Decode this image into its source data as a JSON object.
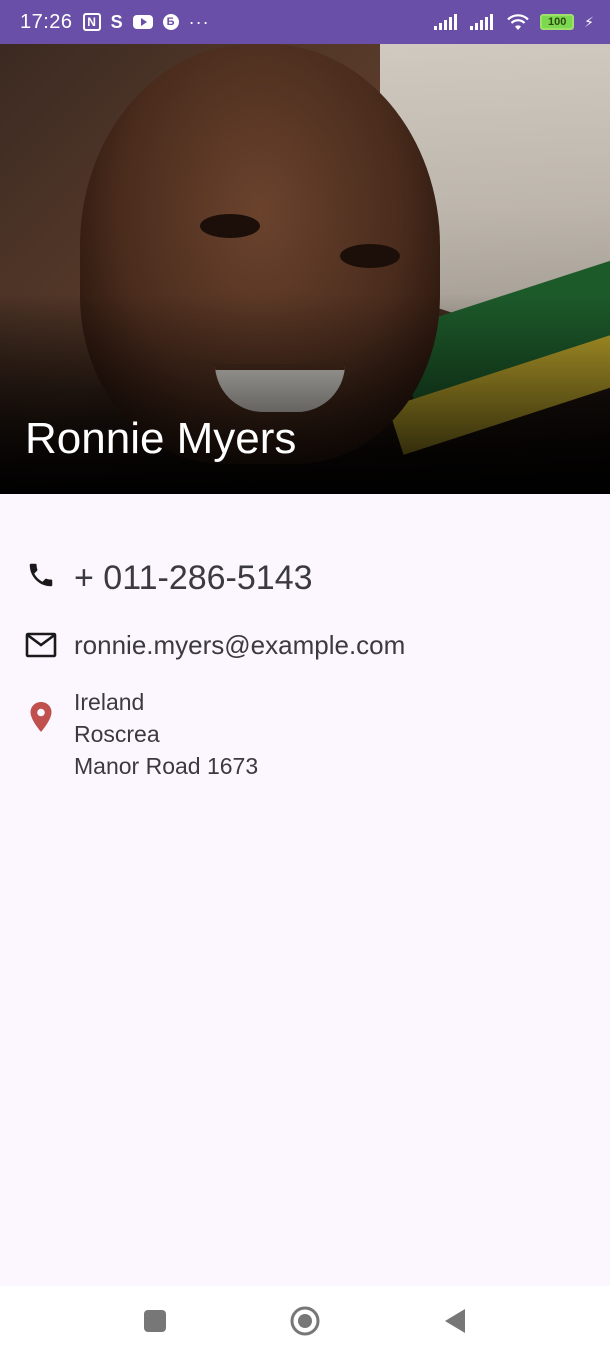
{
  "status_bar": {
    "time": "17:26",
    "nfc_label": "N",
    "s_label": "S",
    "b_label": "Б",
    "more_label": "···",
    "battery_level": "100"
  },
  "contact": {
    "name": "Ronnie Myers",
    "phone": "+ 011-286-5143",
    "email": "ronnie.myers@example.com",
    "address": {
      "country": "Ireland",
      "city": "Roscrea",
      "street": "Manor Road 1673"
    }
  },
  "colors": {
    "status_bar_bg": "#6a4fa8",
    "background": "#fcf6ff",
    "location_icon": "#c0504d",
    "text": "#3b3a40"
  },
  "icons": {
    "phone": "phone-icon",
    "email": "mail-icon",
    "location": "location-pin-icon",
    "nav_recents": "square-icon",
    "nav_home": "circle-icon",
    "nav_back": "triangle-back-icon"
  }
}
